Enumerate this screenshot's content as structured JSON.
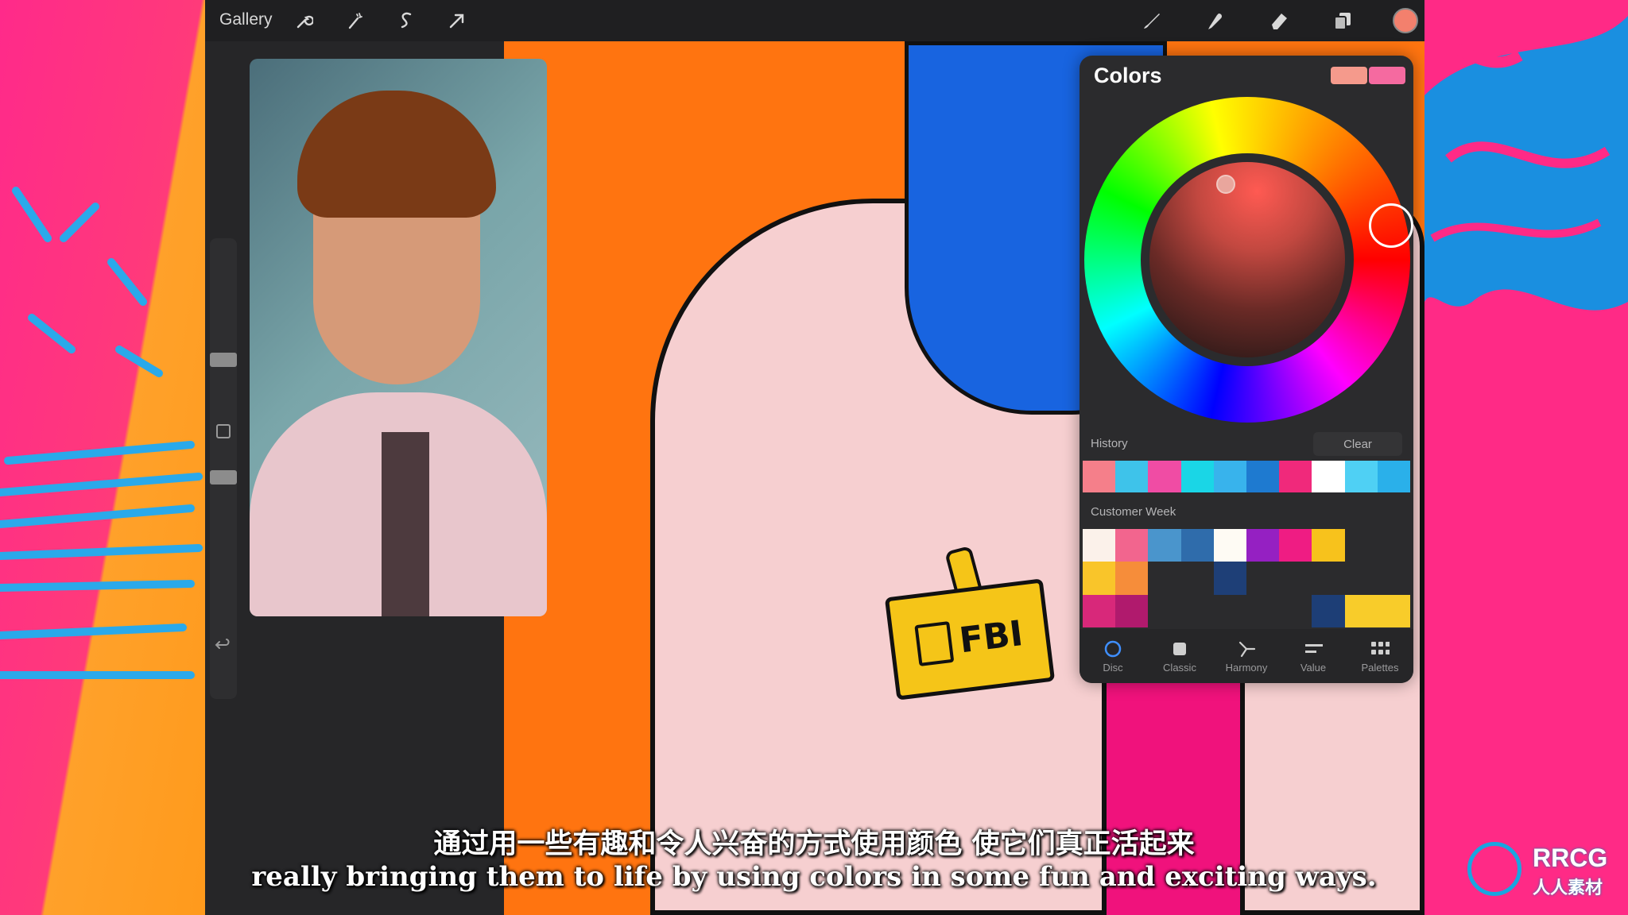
{
  "toolbar": {
    "gallery_label": "Gallery",
    "left_icons": [
      "wrench-icon",
      "magic-wand-icon",
      "selection-icon",
      "transform-arrow-icon"
    ],
    "right_icons": [
      "brush-icon",
      "smudge-icon",
      "eraser-icon",
      "layers-icon"
    ],
    "current_color": "#f3806d"
  },
  "illustration": {
    "badge_text": "FBI"
  },
  "colors_panel": {
    "title": "Colors",
    "current_swatches": [
      "#f59a8c",
      "#f56aa0"
    ],
    "history_label": "History",
    "clear_label": "Clear",
    "history_colors": [
      "#f57f8a",
      "#3ec3ea",
      "#f04ca4",
      "#1ad6e6",
      "#38b3ec",
      "#1e7ad0",
      "#f0297b",
      "#ffffff",
      "#4fd0f4",
      "#2ab0ea"
    ],
    "palette_label": "Customer Week",
    "palette_colors": [
      "#fbf1ea",
      "#f2658e",
      "#4a95cc",
      "#2f6cab",
      "#fefbf4",
      "#9520c2",
      "#ef1c83",
      "#f7c21c",
      "#2b2b2d",
      "#2b2b2d",
      "#f9c52a",
      "#f68d3a",
      "#2b2b2d",
      "#2b2b2d",
      "#1e3f77",
      "#2b2b2d",
      "#2b2b2d",
      "#2b2b2d",
      "#2b2b2d",
      "#2b2b2d",
      "#d8287a",
      "#b01a6d",
      "#2b2b2d",
      "#2b2b2d",
      "#2b2b2d",
      "#2b2b2d",
      "#2b2b2d",
      "#1d3e76",
      "#f8cc2a",
      "#f8cc2a"
    ],
    "tabs": [
      {
        "label": "Disc",
        "icon": "disc-icon",
        "active": true
      },
      {
        "label": "Classic",
        "icon": "square-icon",
        "active": false
      },
      {
        "label": "Harmony",
        "icon": "harmony-icon",
        "active": false
      },
      {
        "label": "Value",
        "icon": "sliders-icon",
        "active": false
      },
      {
        "label": "Palettes",
        "icon": "grid-icon",
        "active": false
      }
    ]
  },
  "subtitles": {
    "chinese": "通过用一些有趣和令人兴奋的方式使用颜色 使它们真正活起来",
    "english": "really bringing them to life by using colors in some fun and exciting ways."
  },
  "watermark": {
    "brand": "RRCG",
    "sub": "人人素材"
  }
}
